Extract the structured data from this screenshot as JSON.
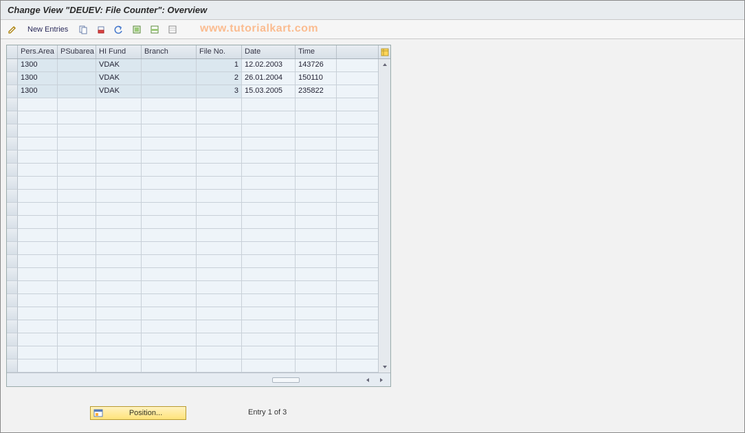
{
  "title": "Change View \"DEUEV: File Counter\": Overview",
  "toolbar": {
    "new_entries_label": "New Entries",
    "icons": [
      "edit-icon",
      "copy-icon",
      "delete-icon",
      "undo-icon",
      "select-all-icon",
      "select-block-icon",
      "deselect-icon"
    ]
  },
  "watermark": "www.tutorialkart.com",
  "table": {
    "columns": [
      {
        "key": "pers_area",
        "label": "Pers.Area",
        "width": "w-pa",
        "align": "left",
        "readonly": true
      },
      {
        "key": "psubarea",
        "label": "PSubarea",
        "width": "w-ps",
        "align": "left",
        "readonly": true
      },
      {
        "key": "hi_fund",
        "label": "HI Fund",
        "width": "w-hi",
        "align": "left",
        "readonly": true
      },
      {
        "key": "branch",
        "label": "Branch",
        "width": "w-br",
        "align": "left",
        "readonly": true
      },
      {
        "key": "file_no",
        "label": "File No.",
        "width": "w-fn",
        "align": "right",
        "readonly": true
      },
      {
        "key": "date",
        "label": "Date",
        "width": "w-dt",
        "align": "left",
        "readonly": false
      },
      {
        "key": "time",
        "label": "Time",
        "width": "w-tm",
        "align": "left",
        "readonly": false
      }
    ],
    "rows": [
      {
        "pers_area": "1300",
        "psubarea": "",
        "hi_fund": "VDAK",
        "branch": "",
        "file_no": "1",
        "date": "12.02.2003",
        "time": "143726"
      },
      {
        "pers_area": "1300",
        "psubarea": "",
        "hi_fund": "VDAK",
        "branch": "",
        "file_no": "2",
        "date": "26.01.2004",
        "time": "150110"
      },
      {
        "pers_area": "1300",
        "psubarea": "",
        "hi_fund": "VDAK",
        "branch": "",
        "file_no": "3",
        "date": "15.03.2005",
        "time": "235822"
      }
    ],
    "empty_row_count": 21,
    "config_icon": "table-settings-icon"
  },
  "footer": {
    "position_button_label": "Position...",
    "entry_label": "Entry 1 of 3"
  },
  "colors": {
    "header_bg": "#e8ecef",
    "grid_header_bg": "#e0e6ec",
    "cell_bg": "#eef4f9",
    "readonly_cell_bg": "#dbe7ef",
    "pos_button_bg": "#ffe37a"
  }
}
